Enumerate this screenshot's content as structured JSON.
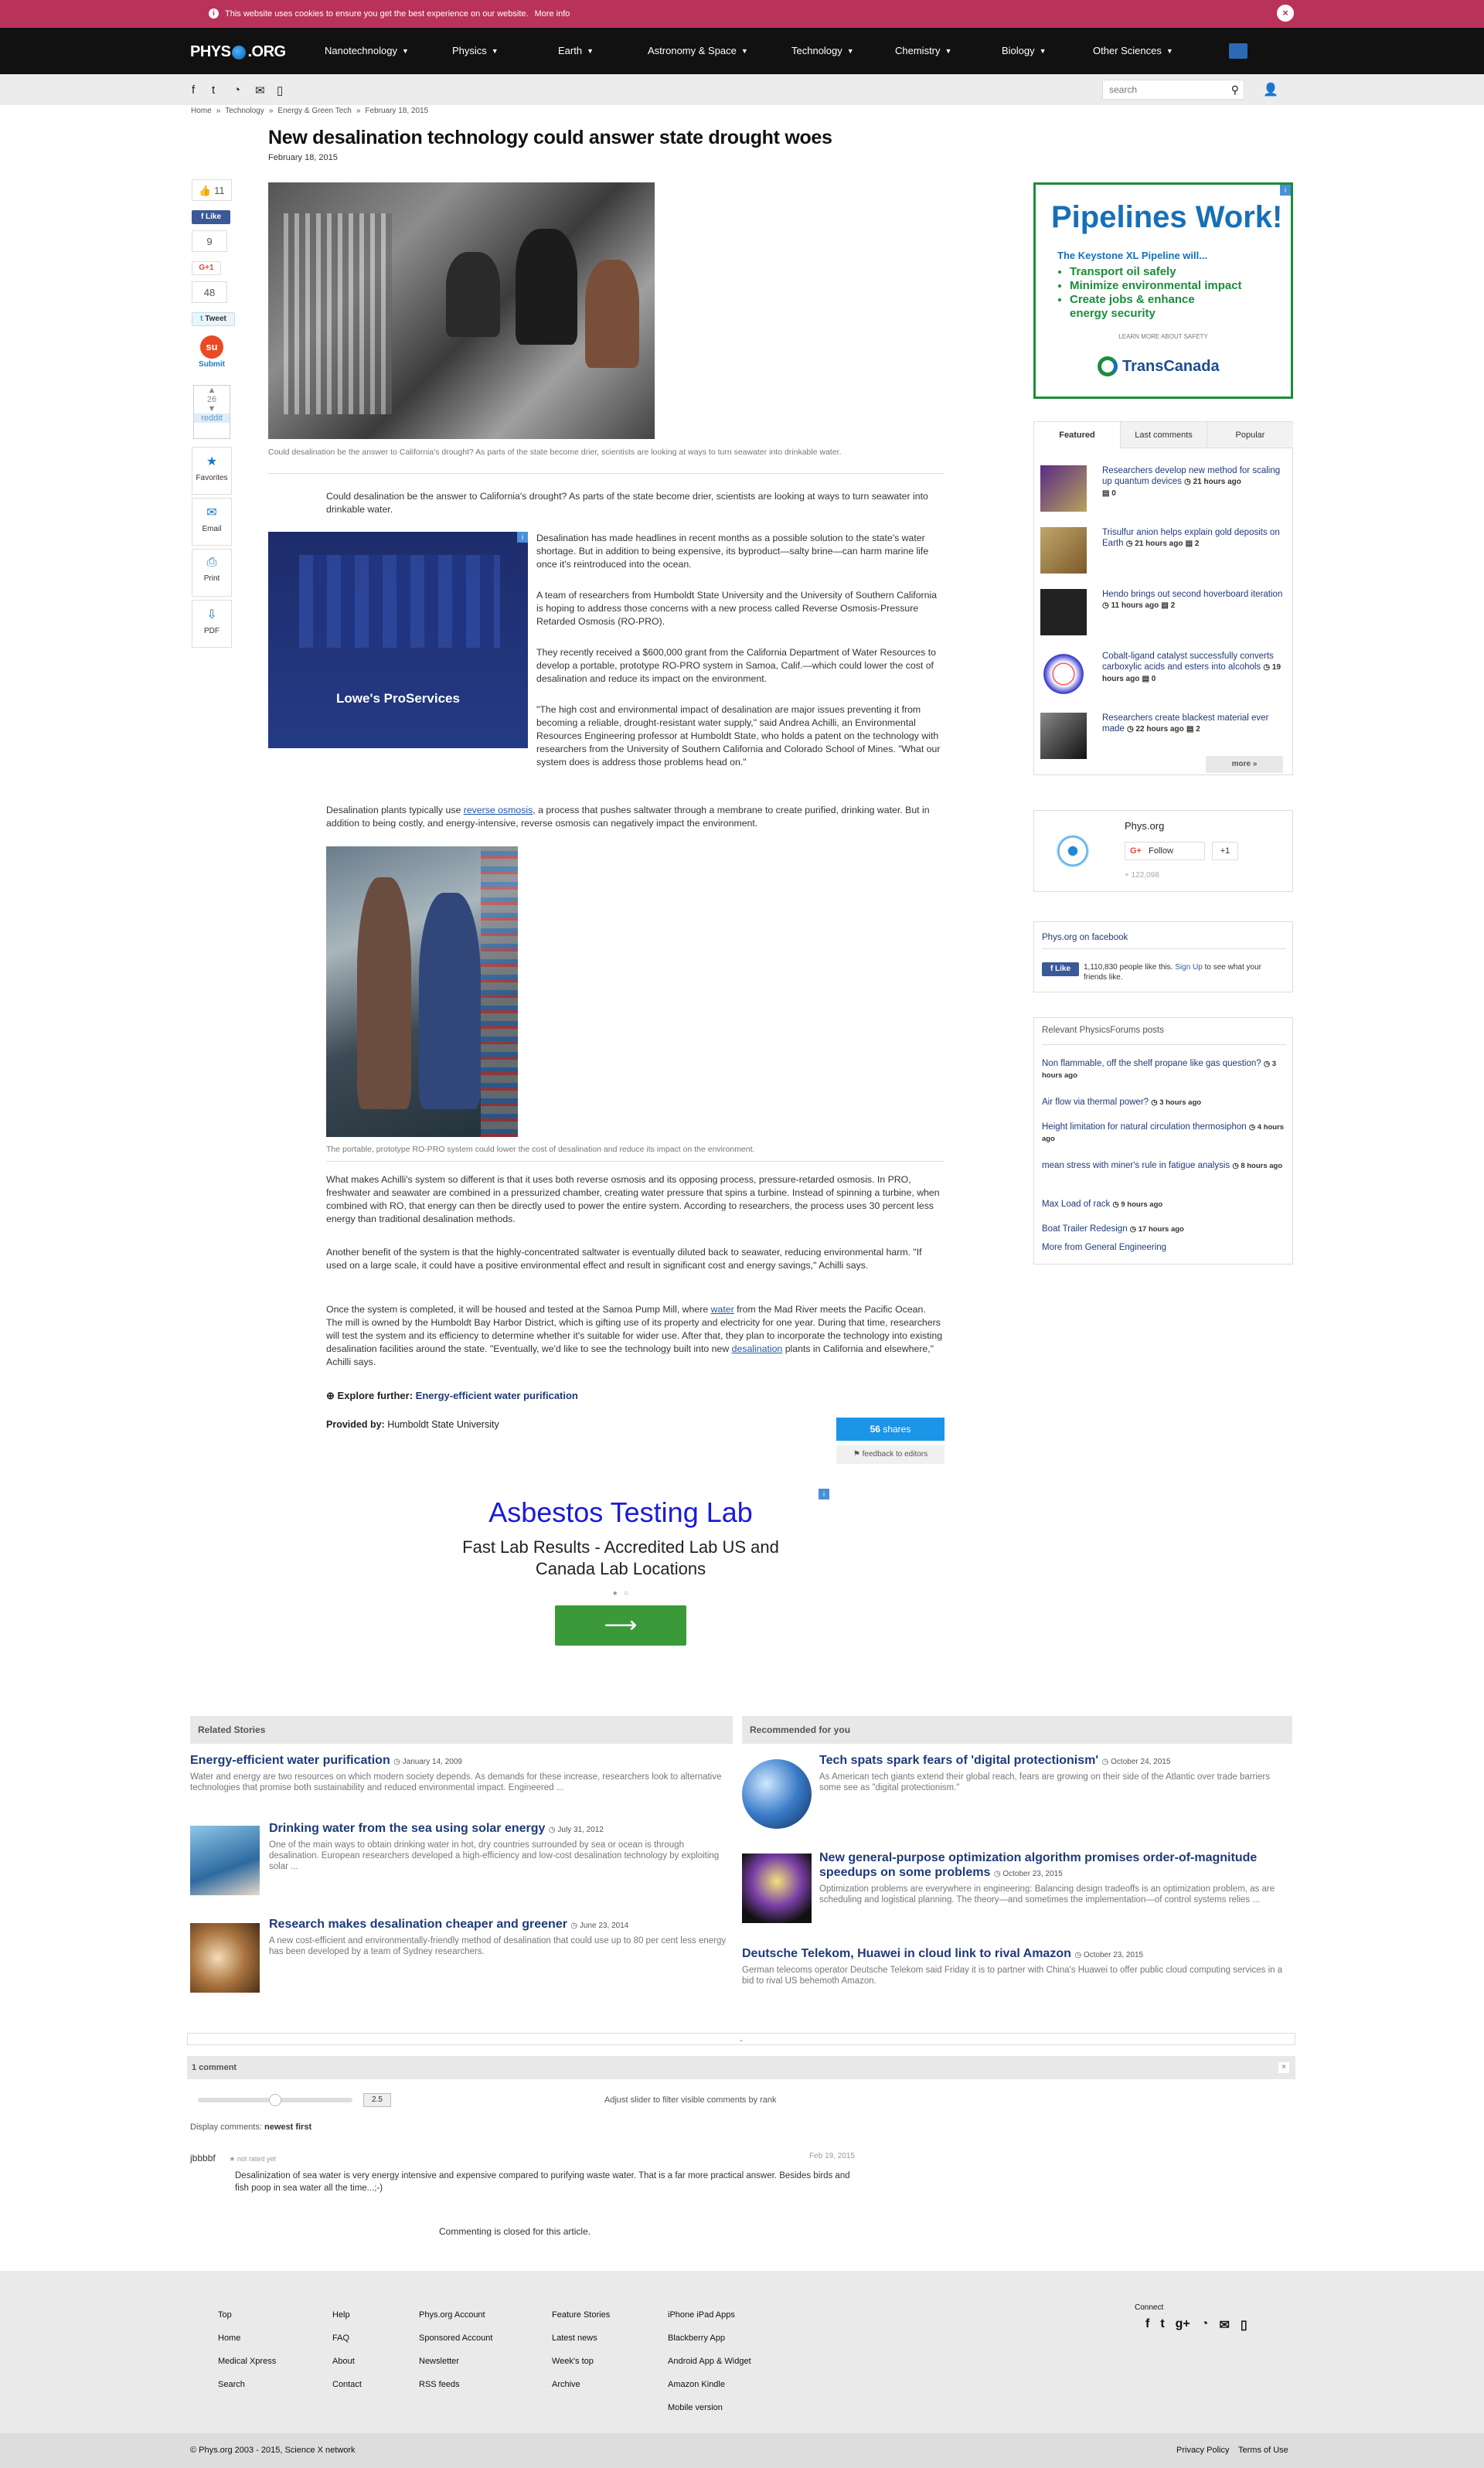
{
  "cookie": {
    "message": "This website uses cookies to ensure you get the best experience on our website.",
    "more": "More info",
    "close": "×"
  },
  "logo": {
    "left": "PHYS",
    "right": ".ORG"
  },
  "nav": [
    "Nanotechnology",
    "Physics",
    "Earth",
    "Astronomy & Space",
    "Technology",
    "Chemistry",
    "Biology",
    "Other Sciences"
  ],
  "search": {
    "placeholder": "search"
  },
  "breadcrumb": [
    "Home",
    "Technology",
    "Energy & Green Tech",
    "February 18, 2015"
  ],
  "article": {
    "title": "New desalination technology could answer state drought woes",
    "date": "February 18, 2015",
    "caption1": "Could desalination be the answer to California's drought? As parts of the state become drier, scientists are looking at ways to turn seawater into drinkable water.",
    "p0": "Could desalination be the answer to California's drought? As parts of the state become drier, scientists are looking at ways to turn seawater into drinkable water.",
    "p1": "Desalination has made headlines in recent months as a possible solution to the state's water shortage. But in addition to being expensive, its byproduct—salty brine—can harm marine life once it's reintroduced into the ocean.",
    "p2": "A team of researchers from Humboldt State University and the University of Southern California is hoping to address those concerns with a new process called Reverse Osmosis-Pressure Retarded Osmosis (RO-PRO).",
    "p3": "They recently received a $600,000 grant from the California Department of Water Resources to develop a portable, prototype RO-PRO system in Samoa, Calif.—which could lower the cost of desalination and reduce its impact on the environment.",
    "p4": "\"The high cost and environmental impact of desalination are major issues preventing it from becoming a reliable, drought-resistant water supply,\" said Andrea Achilli, an Environmental Resources Engineering professor at Humboldt State, who holds a patent on the technology with researchers from the University of Southern California and Colorado School of Mines. \"What our system does is address those problems head on.\"",
    "p5a": "Desalination plants typically use ",
    "p5link": "reverse osmosis",
    "p5b": ", a process that pushes saltwater through a membrane to create purified, drinking water. But in addition to being costly, and energy-intensive, reverse osmosis can negatively impact the environment.",
    "caption2": "The portable, prototype RO-PRO system could lower the cost of desalination and reduce its impact on the environment.",
    "p6": "What makes Achilli's system so different is that it uses both reverse osmosis and its opposing process, pressure-retarded osmosis. In PRO, freshwater and seawater are combined in a pressurized chamber, creating water pressure that spins a turbine. Instead of spinning a turbine, when combined with RO, that energy can then be directly used to power the entire system. According to researchers, the process uses 30 percent less energy than traditional desalination methods.",
    "p7": "Another benefit of the system is that the highly-concentrated saltwater is eventually diluted back to seawater, reducing environmental harm. \"If used on a large scale, it could have a positive environmental effect and result in significant cost and energy savings,\" Achilli says.",
    "p8a": "Once the system is completed, it will be housed and tested at the Samoa Pump Mill, where ",
    "p8link1": "water",
    "p8b": " from the Mad River meets the Pacific Ocean. The mill is owned by the Humboldt Bay Harbor District, which is gifting use of its property and electricity for one year. During that time, researchers will test the system and its efficiency to determine whether it's suitable for wider use. After that, they plan to incorporate the technology into existing desalination facilities around the state. \"Eventually, we'd like to see the technology built into new ",
    "p8link2": "desalination",
    "p8c": " plants in California and elsewhere,\" Achilli says.",
    "explore_label": "Explore further:",
    "explore_link": "Energy-efficient water purification",
    "provided_label": "Provided by:",
    "provided_value": "Humboldt State University",
    "shares": "56",
    "shares_label": "shares",
    "feedback": "feedback to editors"
  },
  "share": {
    "likes": "11",
    "fb_like": "Like",
    "fb_count": "9",
    "gplus": "G+1",
    "tw_count": "48",
    "tweet": "Tweet",
    "submit": "Submit",
    "reddit_count": "26",
    "reddit": "reddit",
    "favorites": "Favorites",
    "email": "Email",
    "print": "Print",
    "pdf": "PDF"
  },
  "ads": {
    "lowes": "Lowe's ProServices",
    "pipelines_title": "Pipelines Work!",
    "pipelines_sub": "The Keystone XL Pipeline will...",
    "pipelines_items": [
      "Transport oil safely",
      "Minimize environmental impact",
      "Create jobs & enhance energy security"
    ],
    "pipelines_learn": "LEARN MORE ABOUT SAFETY",
    "pipelines_brand": "TransCanada",
    "asbestos_title": "Asbestos Testing Lab",
    "asbestos_sub": "Fast Lab Results - Accredited Lab US and Canada Lab Locations"
  },
  "tabs": {
    "labels": [
      "Featured",
      "Last comments",
      "Popular"
    ],
    "items": [
      {
        "title": "Researchers develop new method for scaling up quantum devices",
        "meta": "21 hours ago",
        "c": "0"
      },
      {
        "title": "Trisulfur anion helps explain gold deposits on Earth",
        "meta": "21 hours ago",
        "c": "2"
      },
      {
        "title": "Hendo brings out second hoverboard iteration",
        "meta": "11 hours ago",
        "c": "2"
      },
      {
        "title": "Cobalt-ligand catalyst successfully converts carboxylic acids and esters into alcohols",
        "meta": "19 hours ago",
        "c": "0"
      },
      {
        "title": "Researchers create blackest material ever made",
        "meta": "22 hours ago",
        "c": "2"
      }
    ],
    "more": "more »"
  },
  "gplus_box": {
    "name": "Phys.org",
    "follow": "Follow",
    "plus1": "+1",
    "count": "+ 122,098"
  },
  "fb_box": {
    "title": "Phys.org on facebook",
    "like": "Like",
    "text": "1,110,830 people like this.",
    "signup": "Sign Up",
    "tail": "to see what your friends like."
  },
  "forums": {
    "title": "Relevant PhysicsForums posts",
    "items": [
      {
        "t": "Non flammable, off the shelf propane like gas question?",
        "m": "3 hours ago"
      },
      {
        "t": "Air flow via thermal power?",
        "m": "3 hours ago"
      },
      {
        "t": "Height limitation for natural circulation thermosiphon",
        "m": "4 hours ago"
      },
      {
        "t": "mean stress with miner's rule in fatigue analysis",
        "m": "8 hours ago"
      },
      {
        "t": "Max Load of rack",
        "m": "9 hours ago"
      },
      {
        "t": "Boat Trailer Redesign",
        "m": "17 hours ago"
      }
    ],
    "more": "More from General Engineering"
  },
  "related": {
    "title": "Related Stories",
    "items": [
      {
        "h": "Energy-efficient water purification",
        "d": "January 14, 2009",
        "s": "Water and energy are two resources on which modern society depends. As demands for these increase, researchers look to alternative technologies that promise both sustainability and reduced environmental impact. Engineered ..."
      },
      {
        "h": "Drinking water from the sea using solar energy",
        "d": "July 31, 2012",
        "s": "One of the main ways to obtain drinking water in hot, dry countries surrounded by sea or ocean is through desalination. European researchers developed a high-efficiency and low-cost desalination technology by exploiting solar ..."
      },
      {
        "h": "Research makes desalination cheaper and greener",
        "d": "June 23, 2014",
        "s": "A new cost-efficient and environmentally-friendly method of desalination that could use up to 80 per cent less energy has been developed by a team of Sydney researchers."
      }
    ]
  },
  "recommended": {
    "title": "Recommended for you",
    "items": [
      {
        "h": "Tech spats spark fears of 'digital protectionism'",
        "d": "October 24, 2015",
        "s": "As American tech giants extend their global reach, fears are growing on their side of the Atlantic over trade barriers some see as \"digital protectionism.\""
      },
      {
        "h": "New general-purpose optimization algorithm promises order-of-magnitude speedups on some problems",
        "d": "October 23, 2015",
        "s": "Optimization problems are everywhere in engineering: Balancing design tradeoffs is an optimization problem, as are scheduling and logistical planning. The theory—and sometimes the implementation—of control systems relies ..."
      },
      {
        "h": "Deutsche Telekom, Huawei in cloud link to rival Amazon",
        "d": "October 23, 2015",
        "s": "German telecoms operator Deutsche Telekom said Friday it is to partner with China's Huawei to offer public cloud computing services in a bid to rival US behemoth Amazon."
      }
    ]
  },
  "comments": {
    "count_label": "1 comment",
    "slider_value": "2.5",
    "slider_hint": "Adjust slider to filter visible comments by rank",
    "display_label": "Display comments:",
    "display_value": "newest first",
    "items": [
      {
        "user": "jbbbbf",
        "rating": "not rated yet",
        "date": "Feb 19, 2015",
        "text": "Desalinization of sea water is very energy intensive and expensive compared to purifying waste water. That is a far more practical answer. Besides birds and fish poop in sea water all the time...;-)"
      }
    ],
    "closed": "Commenting is closed for this article."
  },
  "footer": {
    "cols": [
      [
        "Top",
        "Home",
        "Medical Xpress",
        "Search"
      ],
      [
        "Help",
        "FAQ",
        "About",
        "Contact"
      ],
      [
        "Phys.org Account",
        "Sponsored Account",
        "Newsletter",
        "RSS feeds"
      ],
      [
        "Feature Stories",
        "Latest news",
        "Week's top",
        "Archive"
      ],
      [
        "iPhone iPad Apps",
        "Blackberry App",
        "Android App & Widget",
        "Amazon Kindle",
        "Mobile version"
      ]
    ],
    "connect": "Connect",
    "copyright": "© Phys.org 2003 - 2015, Science X network",
    "privacy": "Privacy Policy",
    "terms": "Terms of Use"
  }
}
